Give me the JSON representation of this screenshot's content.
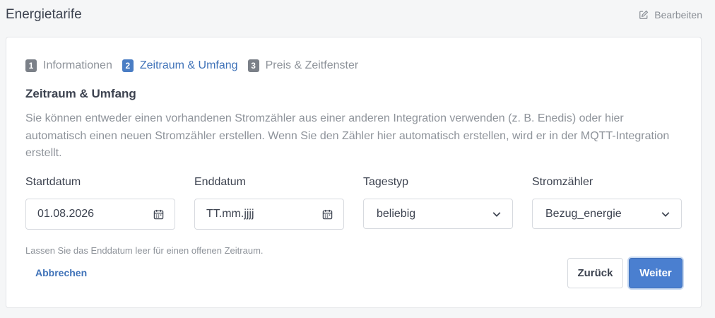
{
  "header": {
    "title": "Energietarife",
    "edit_label": "Bearbeiten"
  },
  "steps": [
    {
      "number": "1",
      "label": "Informationen"
    },
    {
      "number": "2",
      "label": "Zeitraum & Umfang"
    },
    {
      "number": "3",
      "label": "Preis & Zeitfenster"
    }
  ],
  "active_step": 2,
  "section": {
    "title": "Zeitraum & Umfang",
    "description": "Sie können entweder einen vorhandenen Stromzähler aus einer anderen Integration verwenden (z. B. Enedis) oder hier automatisch einen neuen Stromzähler erstellen. Wenn Sie den Zähler hier automatisch erstellen, wird er in der MQTT-Integration erstellt."
  },
  "fields": {
    "start": {
      "label": "Startdatum",
      "value": "01.08.2026",
      "icon": "calendar-icon"
    },
    "end": {
      "label": "Enddatum",
      "placeholder": "TT.mm.jjjj",
      "value": "",
      "icon": "calendar-icon"
    },
    "day_type": {
      "label": "Tagestyp",
      "value": "beliebig",
      "icon": "chevron-down-icon"
    },
    "meter": {
      "label": "Stromzähler",
      "value": "Bezug_energie",
      "icon": "chevron-down-icon"
    }
  },
  "hint": "Lassen Sie das Enddatum leer für einen offenen Zeitraum.",
  "actions": {
    "cancel_label": "Abbrechen",
    "back_label": "Zurück",
    "next_label": "Weiter"
  },
  "colors": {
    "accent": "#4a7fd0",
    "link": "#3f72b8",
    "muted": "#8e939a",
    "step_inactive": "#7b8088"
  }
}
